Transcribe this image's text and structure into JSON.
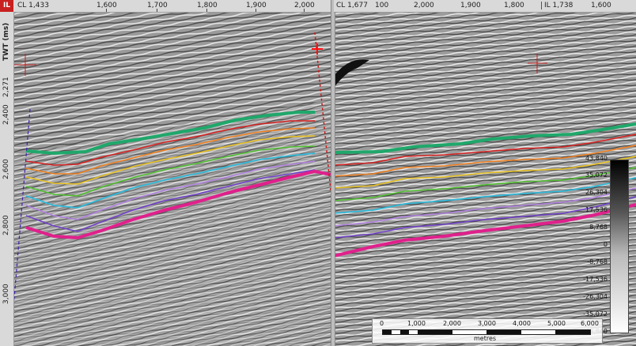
{
  "left_panel": {
    "tag": "IL",
    "cross_line": "CL 1,433",
    "ruler_labels": [
      "1,600",
      "1,700",
      "1,800",
      "1,900",
      "2,000"
    ]
  },
  "right_panel": {
    "cross_line": "CL 1,677",
    "ruler_labels": [
      "100",
      "2,000",
      "1,900",
      "1,800"
    ],
    "inline": "IL 1,738",
    "ruler_last": "1,600"
  },
  "vertical_axis": {
    "title": "TWT (ms)",
    "labels": [
      "2,271",
      "2,400",
      "2,600",
      "2,800",
      "3,000"
    ]
  },
  "colorbar": {
    "labels": [
      "43,840",
      "35,072",
      "26,304",
      "17,536",
      "8,768",
      "0",
      "-8,768",
      "-17,536",
      "-26,304",
      "-35,072",
      "-43,840"
    ]
  },
  "scalebar": {
    "labels": [
      "0",
      "1,000",
      "2,000",
      "3,000",
      "4,000",
      "5,000",
      "6,000"
    ],
    "units": "metres"
  },
  "horizons": {
    "colors": [
      "#1fa86b",
      "#d62020",
      "#f08020",
      "#e8c020",
      "#50c030",
      "#30b8d8",
      "#b080e0",
      "#7040c8",
      "#e0208c"
    ]
  }
}
